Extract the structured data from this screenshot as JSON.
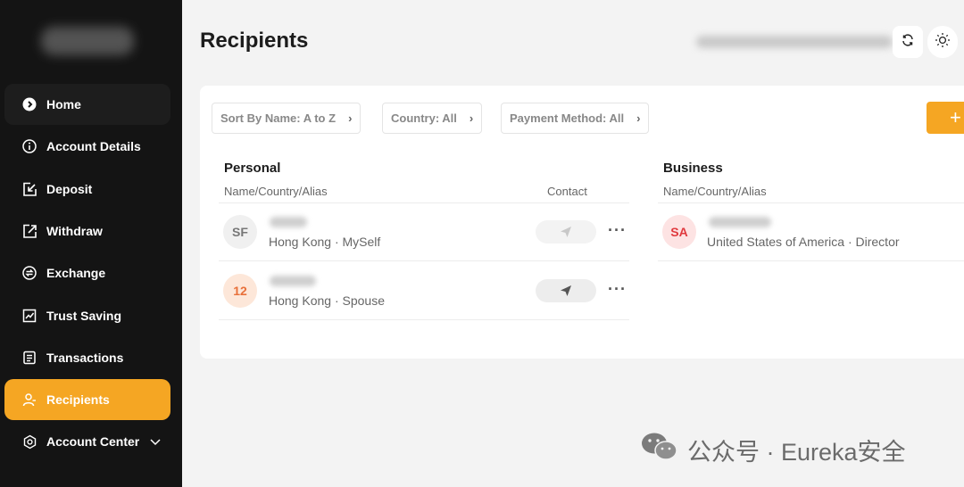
{
  "sidebar": {
    "items": [
      {
        "label": "Home",
        "icon": "home-icon"
      },
      {
        "label": "Account Details",
        "icon": "info-icon"
      },
      {
        "label": "Deposit",
        "icon": "deposit-icon"
      },
      {
        "label": "Withdraw",
        "icon": "withdraw-icon"
      },
      {
        "label": "Exchange",
        "icon": "exchange-icon"
      },
      {
        "label": "Trust Saving",
        "icon": "trust-saving-icon"
      },
      {
        "label": "Transactions",
        "icon": "transactions-icon"
      },
      {
        "label": "Recipients",
        "icon": "recipients-icon",
        "active": true
      },
      {
        "label": "Account Center",
        "icon": "account-center-icon"
      }
    ]
  },
  "page": {
    "title": "Recipients"
  },
  "filters": {
    "sort": "Sort By Name: A to Z",
    "country": "Country: All",
    "payment": "Payment Method: All",
    "add": "+"
  },
  "personal": {
    "title": "Personal",
    "col_name": "Name/Country/Alias",
    "col_contact": "Contact",
    "rows": [
      {
        "initials": "SF",
        "detail": "Hong Kong · MySelf"
      },
      {
        "initials": "12",
        "detail": "Hong Kong · Spouse"
      }
    ]
  },
  "business": {
    "title": "Business",
    "col_name": "Name/Country/Alias",
    "rows": [
      {
        "initials": "SA",
        "detail": "United States of America · Director"
      }
    ]
  },
  "watermark": {
    "text": "公众号 · Eureka安全"
  },
  "colors": {
    "accent": "#f5a623",
    "sidebar": "#141414"
  }
}
